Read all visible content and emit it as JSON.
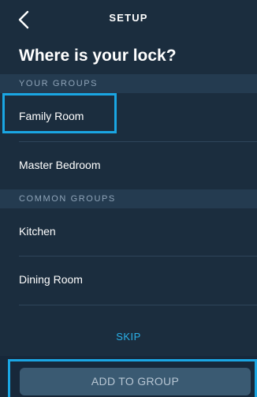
{
  "header": {
    "title": "SETUP",
    "back_icon": "chevron-left-icon"
  },
  "title": "Where is your lock?",
  "your_groups": {
    "label": "YOUR GROUPS",
    "items": [
      "Family Room",
      "Master Bedroom"
    ]
  },
  "common_groups": {
    "label": "COMMON GROUPS",
    "items": [
      "Kitchen",
      "Dining Room"
    ]
  },
  "skip_label": "SKIP",
  "add_button_label": "ADD TO GROUP",
  "colors": {
    "background": "#1b2d3e",
    "section": "#243b50",
    "accent": "#1aa6e3",
    "button": "#3a5a72"
  }
}
